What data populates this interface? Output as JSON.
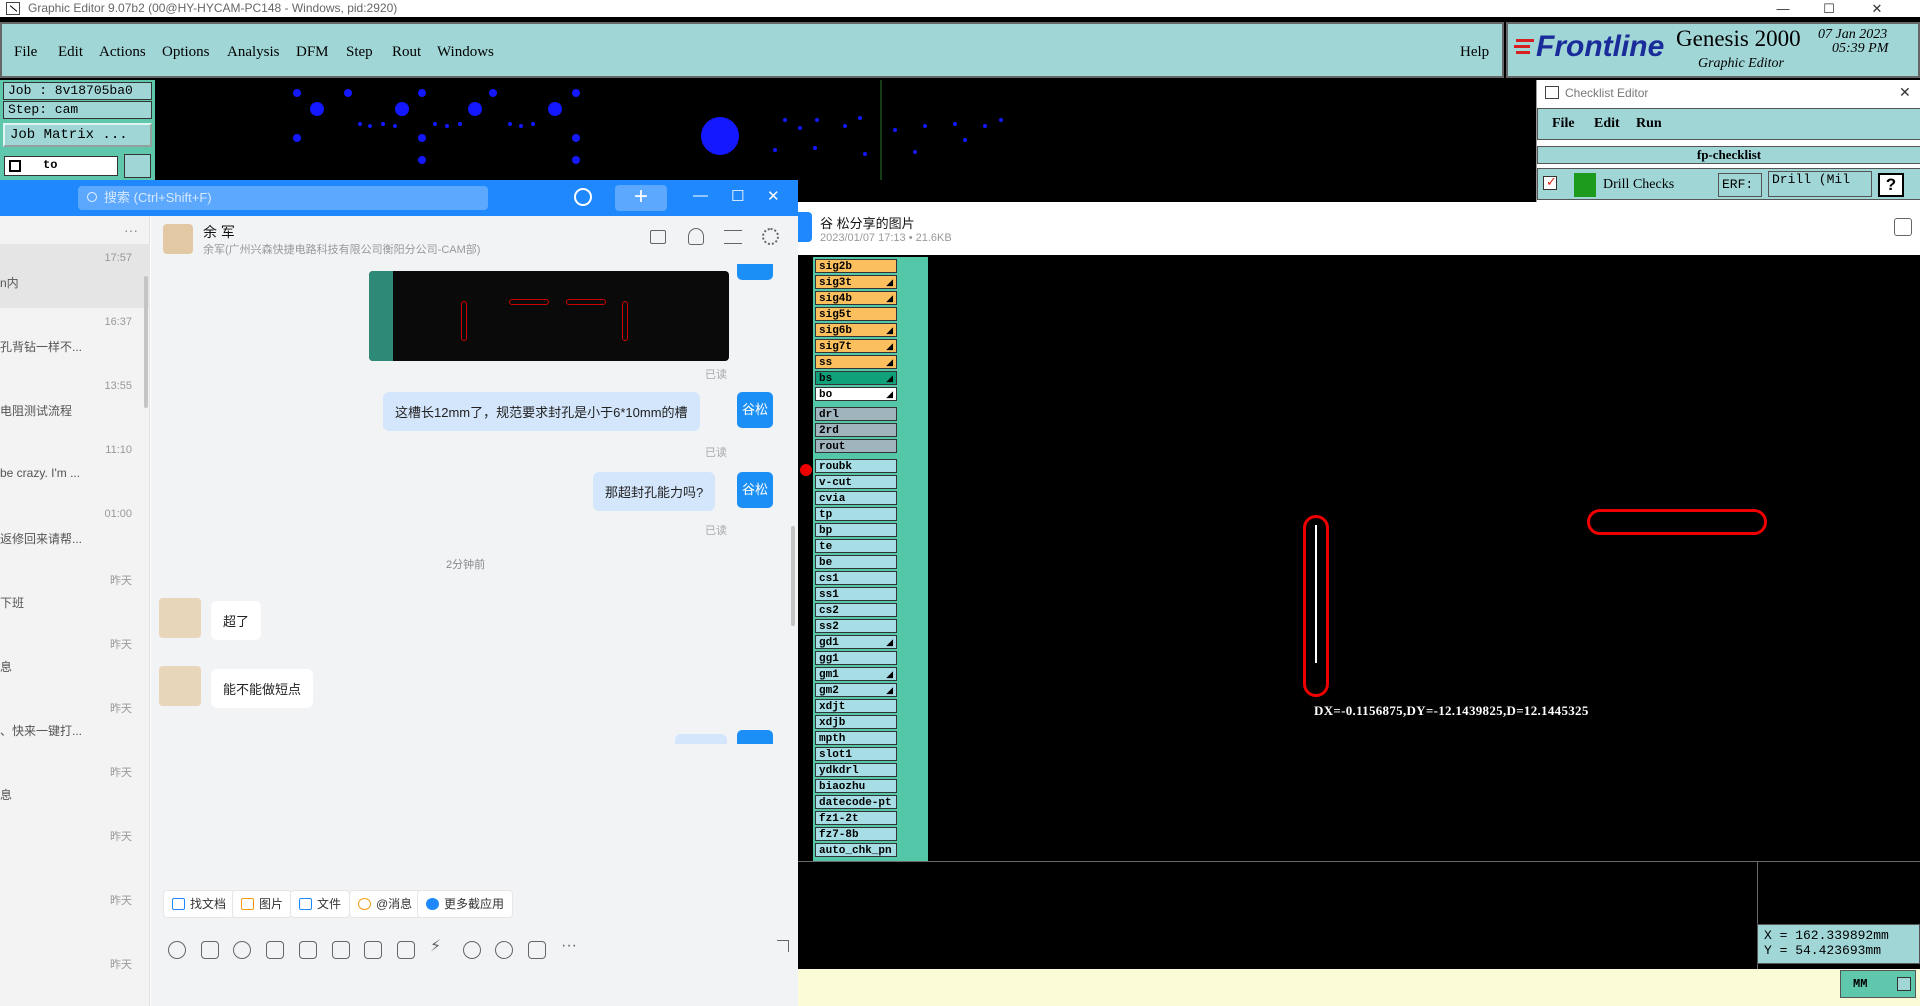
{
  "window": {
    "title": "Graphic Editor 9.07b2 (00@HY-HYCAM-PC148 - Windows, pid:2920)"
  },
  "menu": [
    "File",
    "Edit",
    "Actions",
    "Options",
    "Analysis",
    "DFM",
    "Step",
    "Rout",
    "Windows"
  ],
  "menu_help": "Help",
  "brand": {
    "logo": "Frontline",
    "product": "Genesis 2000",
    "subtitle": "Graphic Editor",
    "date": "07 Jan 2023",
    "time": "05:39 PM"
  },
  "job": {
    "job_label": "Job : 8v18705ba0",
    "step_label": "Step: cam",
    "matrix_button": "Job Matrix ...",
    "to_field": "to"
  },
  "checklist": {
    "title": "Checklist Editor",
    "menu": [
      "File",
      "Edit",
      "Run"
    ],
    "name": "fp-checklist",
    "item": "Drill Checks",
    "erf_label": "ERF:",
    "erf_value": "Drill (Mil",
    "help": "?"
  },
  "qq": {
    "search_placeholder": "搜索 (Ctrl+Shift+F)",
    "conversations": [
      {
        "time": "17:57",
        "msg": "n内"
      },
      {
        "time": "16:37",
        "msg": "孔背钻一样不..."
      },
      {
        "time": "13:55",
        "msg": "电阻测试流程"
      },
      {
        "time": "11:10",
        "msg": "be crazy. I'm ..."
      },
      {
        "time": "01:00",
        "msg": "返修回来请帮..."
      },
      {
        "time": "昨天",
        "msg": "下班"
      },
      {
        "time": "昨天",
        "msg": "息"
      },
      {
        "time": "昨天",
        "msg": "、快来一键打..."
      },
      {
        "time": "昨天",
        "msg": "息"
      },
      {
        "time": "昨天",
        "msg": ""
      },
      {
        "time": "昨天",
        "msg": ""
      },
      {
        "time": "昨天",
        "msg": ""
      }
    ],
    "contact": {
      "name": "余 军",
      "org": "余军(广州兴森快捷电路科技有限公司衡阳分公司-CAM部)"
    },
    "messages": {
      "read1": "已读",
      "msg1": "这槽长12mm了，规范要求封孔是小于6*10mm的槽",
      "read2": "已读",
      "msg2": "那超封孔能力吗?",
      "read3": "已读",
      "time_sep": "2分钟前",
      "reply1": "超了",
      "reply2": "能不能做短点",
      "self_avatar": "谷松"
    },
    "tools": [
      "找文档",
      "图片",
      "文件",
      "@消息",
      "更多截应用"
    ]
  },
  "image_viewer": {
    "title": "谷 松分享的图片",
    "meta": "2023/01/07 17:13 • 21.6KB"
  },
  "layers": [
    {
      "name": "sig2b",
      "type": "sig"
    },
    {
      "name": "sig3t",
      "type": "sig",
      "arrow": true
    },
    {
      "name": "sig4b",
      "type": "sig",
      "arrow": true
    },
    {
      "name": "sig5t",
      "type": "sig"
    },
    {
      "name": "sig6b",
      "type": "sig",
      "arrow": true
    },
    {
      "name": "sig7t",
      "type": "sig",
      "arrow": true
    },
    {
      "name": "ss",
      "type": "sig",
      "arrow": true
    },
    {
      "name": "bs",
      "type": "bs",
      "arrow": true
    },
    {
      "name": "bo",
      "type": "bo",
      "arrow": true
    },
    {
      "name": "drl",
      "type": "drl"
    },
    {
      "name": "2rd",
      "type": "drl"
    },
    {
      "name": "rout",
      "type": "drl"
    },
    {
      "name": "roubk",
      "type": "cy"
    },
    {
      "name": "v-cut",
      "type": "cy"
    },
    {
      "name": "cvia",
      "type": "cy"
    },
    {
      "name": "tp",
      "type": "cy"
    },
    {
      "name": "bp",
      "type": "cy"
    },
    {
      "name": "te",
      "type": "cy"
    },
    {
      "name": "be",
      "type": "cy"
    },
    {
      "name": "cs1",
      "type": "cy"
    },
    {
      "name": "ss1",
      "type": "cy"
    },
    {
      "name": "cs2",
      "type": "cy"
    },
    {
      "name": "ss2",
      "type": "cy"
    },
    {
      "name": "gd1",
      "type": "cy",
      "arrow": true
    },
    {
      "name": "gg1",
      "type": "cy"
    },
    {
      "name": "gm1",
      "type": "cy",
      "arrow": true
    },
    {
      "name": "gm2",
      "type": "cy",
      "arrow": true
    },
    {
      "name": "xdjt",
      "type": "cy"
    },
    {
      "name": "xdjb",
      "type": "cy"
    },
    {
      "name": "mpth",
      "type": "cy"
    },
    {
      "name": "slot1",
      "type": "cy"
    },
    {
      "name": "ydkdrl",
      "type": "cy"
    },
    {
      "name": "biaozhu",
      "type": "cy"
    },
    {
      "name": "datecode-pt",
      "type": "cy"
    },
    {
      "name": "fz1-2t",
      "type": "cy"
    },
    {
      "name": "fz7-8b",
      "type": "cy"
    },
    {
      "name": "auto_chk_pn",
      "type": "cy"
    }
  ],
  "measure": "DX=-0.1156875,DY=-12.1439825,D=12.1445325",
  "coords": {
    "x": "X  = 162.339892mm",
    "y": "Y  = 54.423693mm"
  },
  "units": "MM",
  "colors": {
    "panel": "#a1d6d7",
    "accent": "#1f88fd",
    "slot": "#e00000"
  }
}
